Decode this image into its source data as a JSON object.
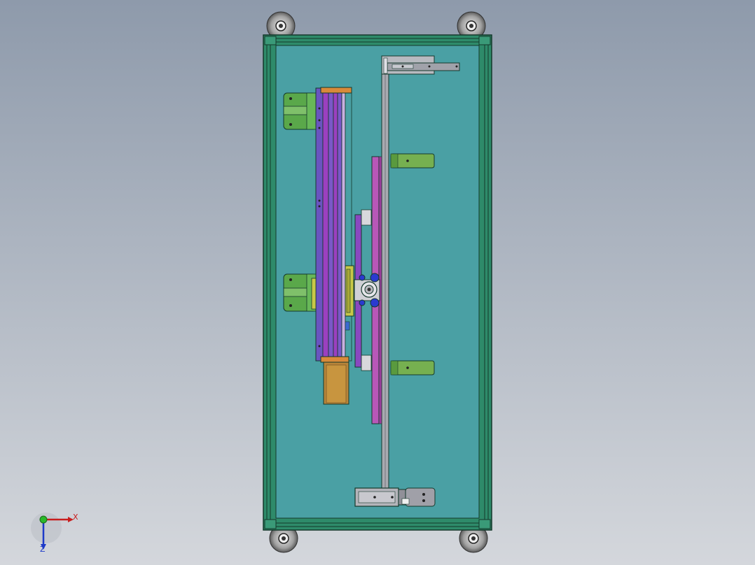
{
  "viewport": {
    "background_top": "#8e9aab",
    "background_bottom": "#d4d7dc"
  },
  "colors": {
    "frame": "#2e8b6a",
    "frame_dark": "#14382b",
    "base_plate": "#4aa0a4",
    "module_purple": "#7a58c8",
    "module_violet": "#9b40c0",
    "magenta": "#b857b8",
    "orange": "#d98a3a",
    "bronze": "#b8853a",
    "olive": "#c8c848",
    "green_bracket": "#5aa84a",
    "green_tab": "#76b050",
    "rail_grey": "#a8aab0",
    "cylinder_grey": "#b4b4ba",
    "blue_part": "#2a3ad0",
    "caster": "#9a9a9a"
  },
  "triad": {
    "x_label": "X",
    "z_label": "Z",
    "x_icon": "x-axis-arrow-icon",
    "z_icon": "z-axis-arrow-icon"
  }
}
